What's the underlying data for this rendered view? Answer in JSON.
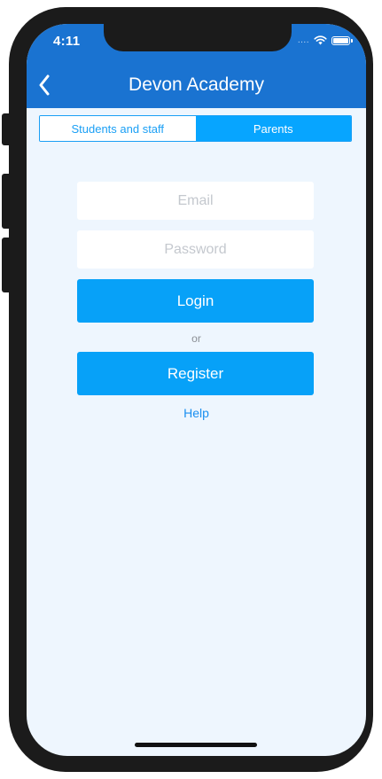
{
  "status_bar": {
    "time": "4:11",
    "signal_dots": "....",
    "wifi_icon": "wifi-icon",
    "battery_icon": "battery-icon"
  },
  "nav": {
    "back_icon": "chevron-left-icon",
    "title": "Devon Academy"
  },
  "segments": {
    "options": [
      "Students and staff",
      "Parents"
    ],
    "selected": "Parents"
  },
  "form": {
    "email_placeholder": "Email",
    "email_value": "",
    "password_placeholder": "Password",
    "password_value": "",
    "login_label": "Login",
    "or_label": "or",
    "register_label": "Register",
    "help_label": "Help"
  },
  "colors": {
    "header": "#1a73d1",
    "accent": "#07a1f8",
    "background": "#eef6fe",
    "link": "#1a8ff0"
  }
}
